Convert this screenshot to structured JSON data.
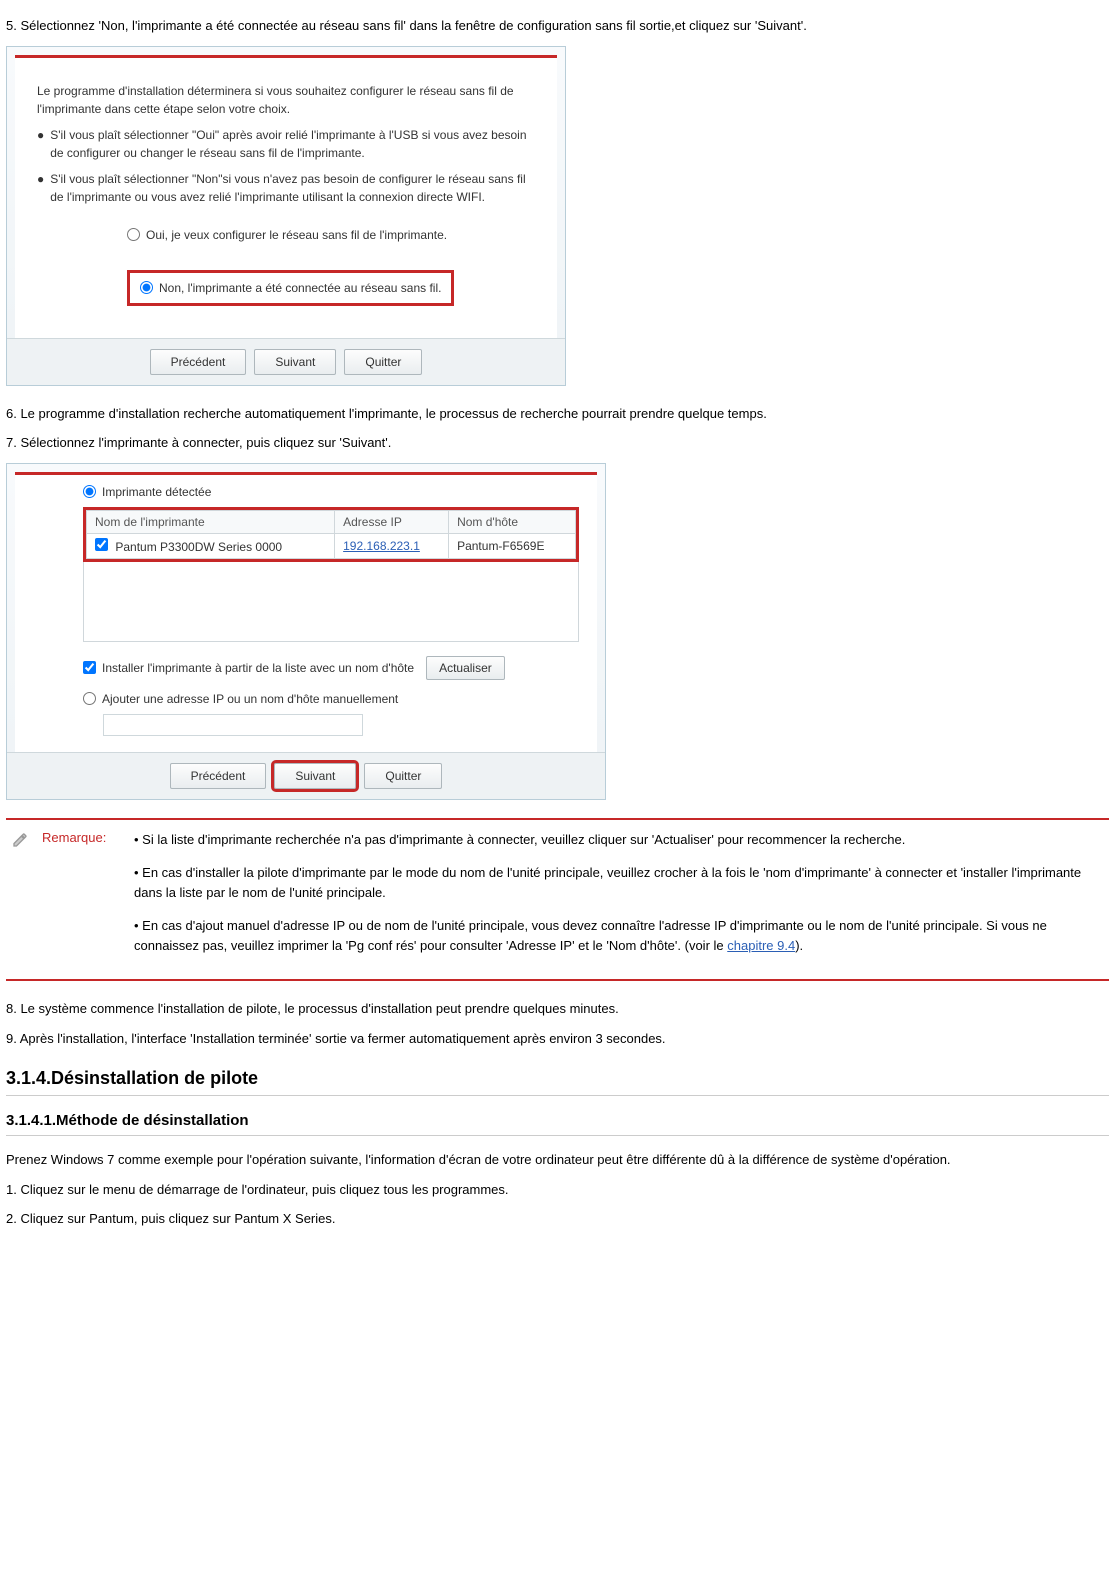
{
  "step5": {
    "text": "5. Sélectionnez 'Non, l'imprimante a été connectée au réseau sans fil' dans la fenêtre de configuration sans fil sortie,et cliquez sur 'Suivant'."
  },
  "dialog1": {
    "intro": "Le programme d'installation déterminera si vous souhaitez configurer le réseau sans fil de l'imprimante dans cette étape selon votre choix.",
    "bullet1": "S'il vous plaît sélectionner \"Oui\" après avoir relié l'imprimante à l'USB si vous avez besoin de configurer ou changer le réseau sans fil de l'imprimante.",
    "bullet2": "S'il vous plaît sélectionner  \"Non\"si vous n'avez pas besoin de configurer le réseau sans fil de l'imprimante ou vous avez relié l'imprimante utilisant la connexion directe WIFI.",
    "option_yes": "Oui, je veux configurer le réseau sans fil de l'imprimante.",
    "option_no": "Non, l'imprimante a été connectée au réseau sans fil.",
    "btn_prev": "Précédent",
    "btn_next": "Suivant",
    "btn_quit": "Quitter"
  },
  "step6": {
    "text": "6. Le programme d'installation recherche automatiquement l'imprimante, le processus de recherche pourrait prendre quelque temps."
  },
  "step7": {
    "text": "7. Sélectionnez l'imprimante à connecter, puis cliquez sur 'Suivant'."
  },
  "dialog2": {
    "detected_label": "Imprimante détectée",
    "col_name": "Nom de l'imprimante",
    "col_ip": "Adresse IP",
    "col_host": "Nom d'hôte",
    "row_name": "Pantum P3300DW Series 0000",
    "row_ip": "192.168.223.1",
    "row_host": "Pantum-F6569E",
    "install_label": "Installer l'imprimante à partir de la liste avec un nom d'hôte",
    "btn_refresh": "Actualiser",
    "manual_label": "Ajouter une adresse IP ou un nom d'hôte manuellement",
    "btn_prev": "Précédent",
    "btn_next": "Suivant",
    "btn_quit": "Quitter"
  },
  "remarque": {
    "label": "Remarque:",
    "p1": "• Si la liste d'imprimante recherchée n'a pas d'imprimante à connecter, veuillez cliquer sur 'Actualiser' pour recommencer la recherche.",
    "p2": "• En cas d'installer la pilote d'imprimante par le mode du nom de l'unité principale, veuillez crocher à la fois le 'nom d'imprimante' à connecter et 'installer l'imprimante dans la liste par le nom de l'unité principale.",
    "p3_before": "• En cas d'ajout manuel d'adresse IP ou de nom de l'unité principale, vous devez connaître l'adresse IP d'imprimante ou le nom de l'unité principale. Si vous ne connaissez pas, veuillez imprimer la 'Pg conf rés' pour consulter 'Adresse IP' et le 'Nom d'hôte'. (voir le ",
    "p3_link": "chapitre 9.4",
    "p3_after": ")."
  },
  "step8": {
    "text": "8. Le système commence l'installation de pilote, le processus d'installation peut prendre quelques minutes."
  },
  "step9": {
    "text": "9. Après l'installation, l'interface 'Installation terminée' sortie va fermer automatiquement après environ 3 secondes."
  },
  "h314": "3.1.4.Désinstallation de pilote",
  "h3141": "3.1.4.1.Méthode de désinstallation",
  "p_after_h3141": "Prenez Windows 7 comme exemple pour l'opération suivante, l'information d'écran de votre ordinateur peut être différente dû à la différence de système d'opération.",
  "step_d1": "1. Cliquez sur le menu de démarrage de l'ordinateur, puis cliquez tous les programmes.",
  "step_d2": "2. Cliquez sur Pantum, puis cliquez sur Pantum X Series."
}
